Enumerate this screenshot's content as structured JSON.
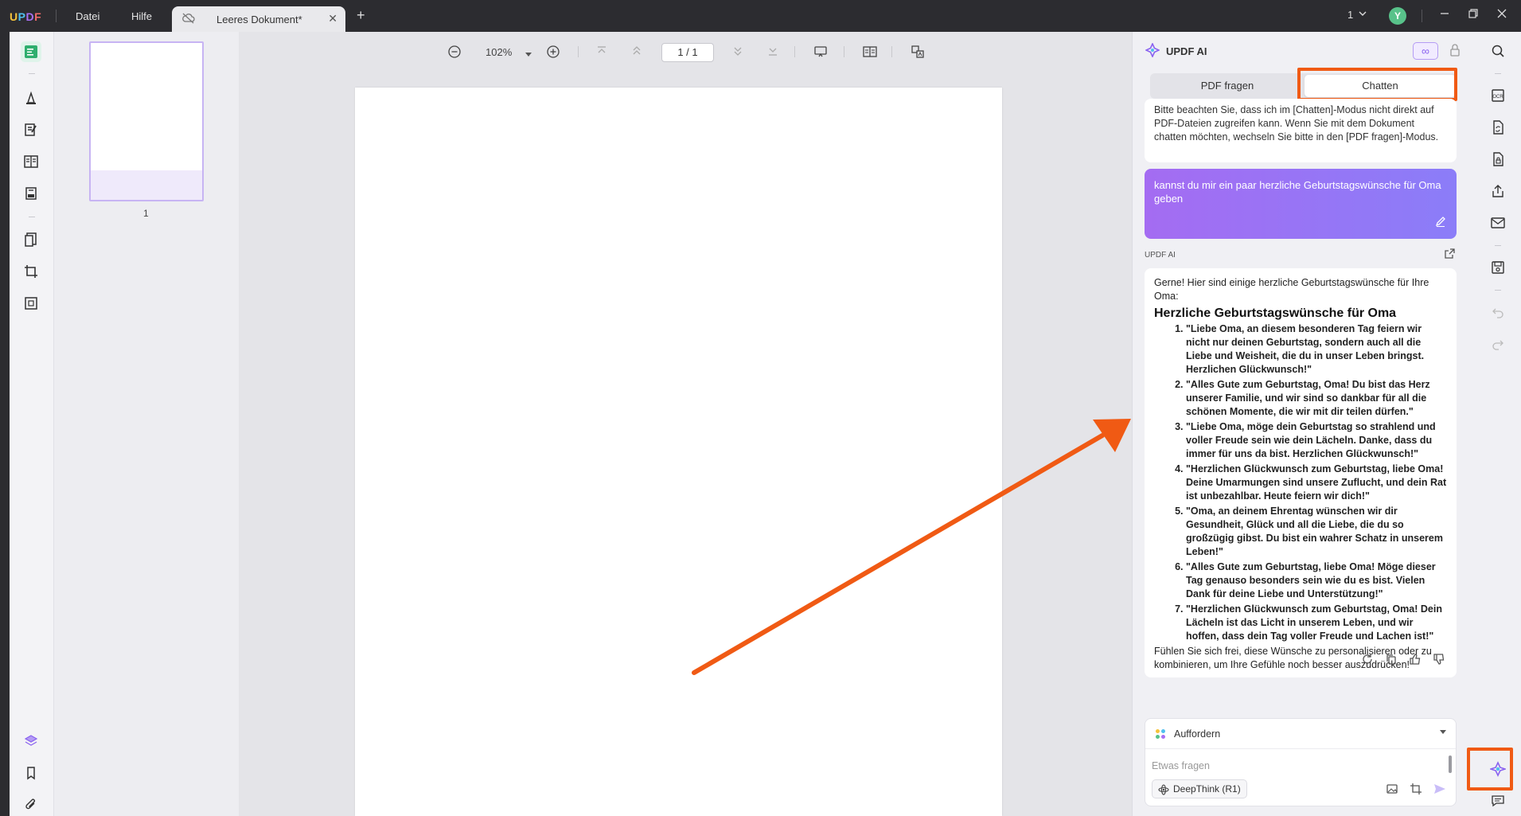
{
  "titlebar": {
    "logo": "UPDF",
    "menu_file": "Datei",
    "menu_help": "Hilfe",
    "tab_title": "Leeres Dokument*",
    "tab_close": "✕",
    "new_tab": "+",
    "page_count_label": "1",
    "avatar_initial": "Y"
  },
  "thumbnails": {
    "page_number": "1"
  },
  "toolbar": {
    "zoom": "102%",
    "page_indicator": "1  /  1"
  },
  "ai_panel": {
    "title": "UPDF AI",
    "infinity": "∞",
    "tab_pdf": "PDF fragen",
    "tab_chat": "Chatten",
    "system_message": "Bitte beachten Sie, dass ich im [Chatten]-Modus nicht direkt auf PDF-Dateien zugreifen kann. Wenn Sie mit dem Dokument chatten möchten, wechseln Sie bitte in den [PDF fragen]-Modus.",
    "user_message": "kannst du mir ein paar herzliche Geburtstagswünsche für Oma geben",
    "ai_label": "UPDF AI",
    "answer_intro": "Gerne! Hier sind einige herzliche Geburtstagswünsche für Ihre Oma:",
    "answer_heading": "Herzliche Geburtstagswünsche für Oma",
    "answer_items": [
      "\"Liebe Oma, an diesem besonderen Tag feiern wir nicht nur deinen Geburtstag, sondern auch all die Liebe und Weisheit, die du in unser Leben bringst. Herzlichen Glückwunsch!\"",
      "\"Alles Gute zum Geburtstag, Oma! Du bist das Herz unserer Familie, und wir sind so dankbar für all die schönen Momente, die wir mit dir teilen dürfen.\"",
      "\"Liebe Oma, möge dein Geburtstag so strahlend und voller Freude sein wie dein Lächeln. Danke, dass du immer für uns da bist. Herzlichen Glückwunsch!\"",
      "\"Herzlichen Glückwunsch zum Geburtstag, liebe Oma! Deine Umarmungen sind unsere Zuflucht, und dein Rat ist unbezahlbar. Heute feiern wir dich!\"",
      "\"Oma, an deinem Ehrentag wünschen wir dir Gesundheit, Glück und all die Liebe, die du so großzügig gibst. Du bist ein wahrer Schatz in unserem Leben!\"",
      "\"Alles Gute zum Geburtstag, liebe Oma! Möge dieser Tag genauso besonders sein wie du es bist. Vielen Dank für deine Liebe und Unterstützung!\"",
      "\"Herzlichen Glückwunsch zum Geburtstag, Oma! Dein Lächeln ist das Licht in unserem Leben, und wir hoffen, dass dein Tag voller Freude und Lachen ist!\""
    ],
    "answer_outro": "Fühlen Sie sich frei, diese Wünsche zu personalisieren oder zu kombinieren, um Ihre Gefühle noch besser auszudrücken!",
    "prompt_label": "Auffordern",
    "input_placeholder": "Etwas fragen",
    "deepthink_label": "DeepThink (R1)"
  },
  "colors": {
    "highlight": "#f05a14",
    "accent_purple": "#8a62f0"
  }
}
